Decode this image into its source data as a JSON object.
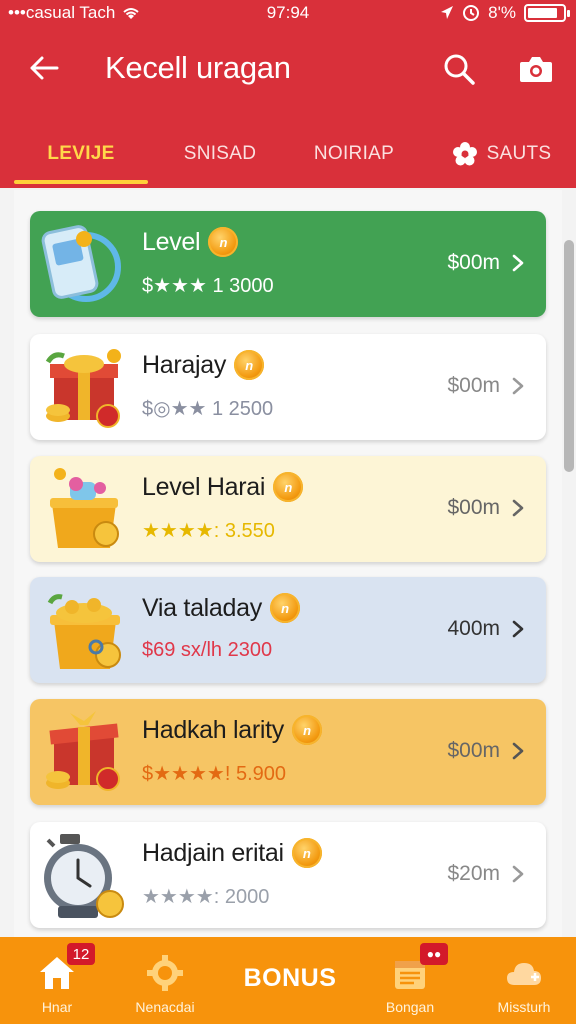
{
  "status_bar": {
    "carrier": "•••casual Tach",
    "time": "97:94",
    "battery_text": "8'%",
    "battery_level": 0.85
  },
  "app_bar": {
    "title": "Kecell uragan",
    "back_icon": "arrow-left-icon",
    "search_icon": "search-icon",
    "camera_icon": "camera-icon"
  },
  "tabs": [
    {
      "label": "LEVIJE",
      "active": true
    },
    {
      "label": "SNISAD",
      "active": false
    },
    {
      "label": "NOIRIAP",
      "active": false
    },
    {
      "label": "SAUTS",
      "active": false,
      "icon": "flower-icon"
    }
  ],
  "items": [
    {
      "name": "Level",
      "sub": "$★★★  1 3000",
      "price": "$00m",
      "rating": 3,
      "thumb": "phone-icon",
      "color": "#42a253"
    },
    {
      "name": "Harajay",
      "sub": "$◎★★ 1  2500",
      "price": "$00m",
      "rating": 2,
      "thumb": "gift-box-icon",
      "color": "#ffffff"
    },
    {
      "name": "Level Harai",
      "sub": "★★★★: 3.550",
      "price": "$00m",
      "rating": 4,
      "thumb": "honey-pot-icon",
      "color": "#fdf5d6"
    },
    {
      "name": "Via taladay",
      "sub": "$69 sx/lh  2300",
      "price": "400m",
      "rating": 0,
      "thumb": "coin-pot-icon",
      "color": "#d9e3f1"
    },
    {
      "name": "Hadkah larity",
      "sub": "$★★★★! 5.900",
      "price": "$00m",
      "rating": 4,
      "thumb": "gift-box-icon",
      "color": "#f6c564"
    },
    {
      "name": "Hadjain eritai",
      "sub": "★★★★: 2000",
      "price": "$20m",
      "rating": 4,
      "thumb": "clock-icon",
      "color": "#ffffff"
    }
  ],
  "bottom_nav": {
    "items": [
      {
        "label": "Hnar",
        "icon": "home-icon",
        "badge": "12"
      },
      {
        "label": "Nenacdai",
        "icon": "gear-icon"
      },
      {
        "label": "Bongan",
        "icon": "calendar-icon",
        "badge": "dots"
      },
      {
        "label": "Missturh",
        "icon": "cloud-icon"
      }
    ],
    "center_label": "BONUS"
  }
}
